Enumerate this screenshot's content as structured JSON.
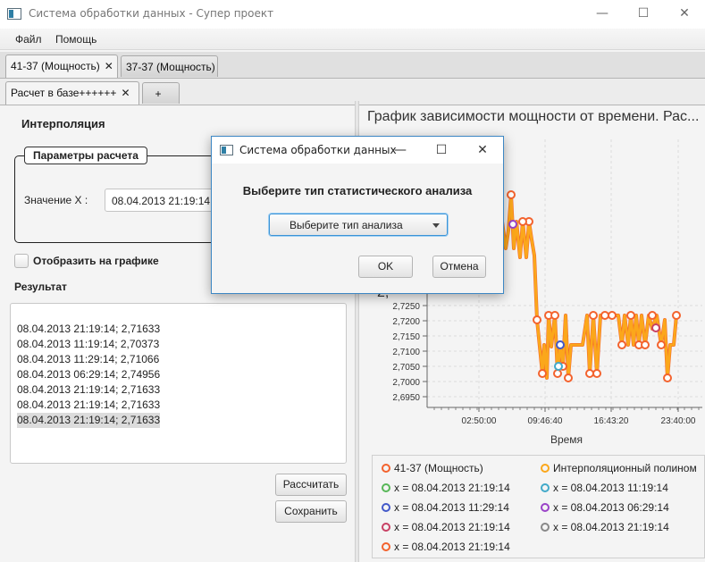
{
  "window": {
    "title": "Система обработки данных - Супер проект",
    "minimize": "—",
    "maximize": "☐",
    "close": "✕"
  },
  "menu": [
    "Файл",
    "Помощь"
  ],
  "tabs_row1": [
    {
      "label": "41-37 (Мощность)",
      "close": "✕"
    },
    {
      "label": "37-37 (Мощность)"
    }
  ],
  "tabs_row2": [
    {
      "label": "Расчет в базе++++++",
      "close": "✕"
    },
    {
      "label": "+"
    }
  ],
  "left": {
    "section_title": "Интерполяция",
    "params_legend": "Параметры расчета",
    "x_label": "Значение Х :",
    "x_value": "08.04.2013 21:19:14",
    "show_on_chart": "Отобразить на графике",
    "result_title": "Результат",
    "results": [
      "08.04.2013 21:19:14; 2,71633",
      "08.04.2013 11:19:14; 2,70373",
      "08.04.2013 11:29:14; 2,71066",
      "08.04.2013 06:29:14; 2,74956",
      "08.04.2013 21:19:14; 2,71633",
      "08.04.2013 21:19:14; 2,71633",
      "08.04.2013 21:19:14; 2,71633"
    ],
    "calc_button": "Рассчитать",
    "save_button": "Сохранить"
  },
  "chart": {
    "title": "График зависимости мощности от времени. Рас...",
    "xlabel": "Время",
    "y_ticks": [
      "2,7250",
      "2,7200",
      "2,7150",
      "2,7100",
      "2,7050",
      "2,7000",
      "2,6950"
    ],
    "y_axis_partial": "2,",
    "x_ticks": [
      "02:50:00",
      "09:46:40",
      "16:43:20",
      "23:40:00"
    ],
    "legend": [
      {
        "label": "41-37 (Мощность)",
        "color": "#f3622d"
      },
      {
        "label": "Интерполяционный полином",
        "color": "#fba71b"
      },
      {
        "label": "x = 08.04.2013 21:19:14",
        "color": "#57b757"
      },
      {
        "label": "x = 08.04.2013 11:19:14",
        "color": "#41a9c9"
      },
      {
        "label": "x = 08.04.2013 11:29:14",
        "color": "#4258c9"
      },
      {
        "label": "x = 08.04.2013 06:29:14",
        "color": "#9a42c8"
      },
      {
        "label": "x = 08.04.2013 21:19:14",
        "color": "#c84164"
      },
      {
        "label": "x = 08.04.2013 21:19:14",
        "color": "#888888"
      },
      {
        "label": "x = 08.04.2013 21:19:14",
        "color": "#f3622d"
      }
    ]
  },
  "dialog": {
    "title": "Система обработки данных",
    "minimize": "—",
    "maximize": "☐",
    "close": "✕",
    "header": "Выберите тип статистического анализа",
    "combo_text": "Выберите тип анализа",
    "ok": "OK",
    "cancel": "Отмена"
  }
}
